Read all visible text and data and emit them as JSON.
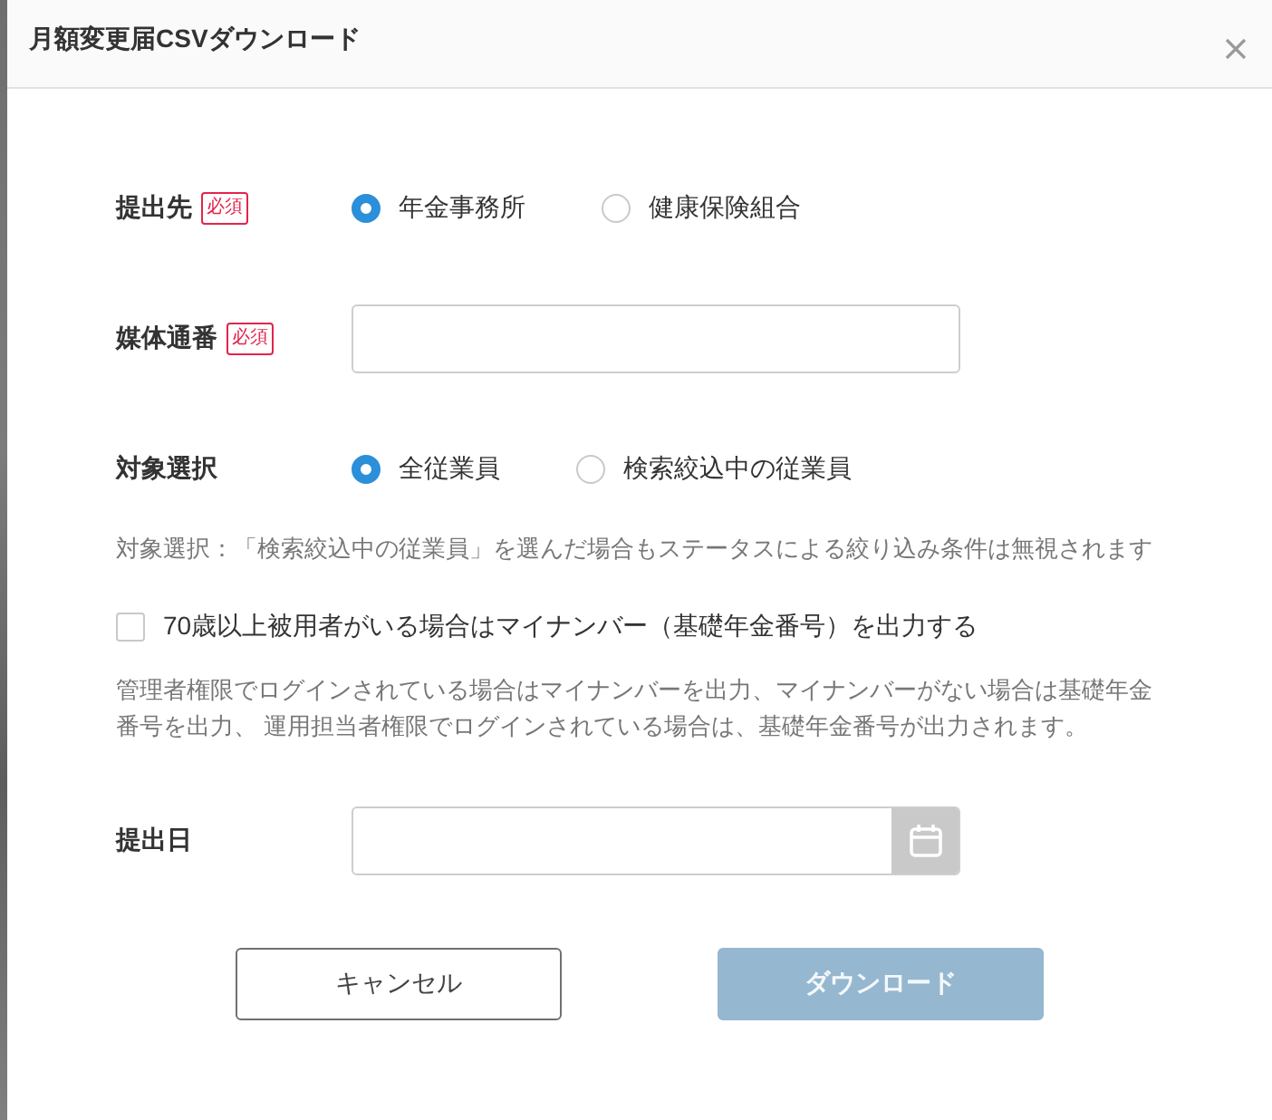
{
  "dialog": {
    "title": "月額変更届CSVダウンロード"
  },
  "form": {
    "rows": [
      {
        "kind": "radio",
        "label": "提出先",
        "badge": "必須",
        "options": [
          {
            "label": "年金事務所",
            "selected": true
          },
          {
            "label": "健康保険組合",
            "selected": false
          }
        ]
      },
      {
        "kind": "text",
        "label": "媒体通番",
        "badge": "必須"
      },
      {
        "kind": "radio",
        "label": "対象選択",
        "options": [
          {
            "label": "全従業員",
            "selected": true
          },
          {
            "label": "検索絞込中の従業員",
            "selected": false
          }
        ]
      },
      {
        "kind": "note",
        "text": "対象選択：「検索絞込中の従業員」を選んだ場合もステータスによる絞り込み条件は無視されます"
      },
      {
        "kind": "checkbox",
        "label": "70歳以上被用者がいる場合はマイナンバー（基礎年金番号）を出力する",
        "checked": false
      },
      {
        "kind": "note",
        "text": "管理者権限でログインされている場合はマイナンバーを出力、マイナンバーがない場合は基礎年金番号を出力、 運用担当者権限でログインされている場合は、基礎年金番号が出力されます。"
      },
      {
        "kind": "date",
        "label": "提出日"
      }
    ]
  },
  "buttons": [
    {
      "label": "キャンセル",
      "kind": "secondary",
      "disabled": false
    },
    {
      "label": "ダウンロード",
      "kind": "primary",
      "disabled": true
    }
  ]
}
